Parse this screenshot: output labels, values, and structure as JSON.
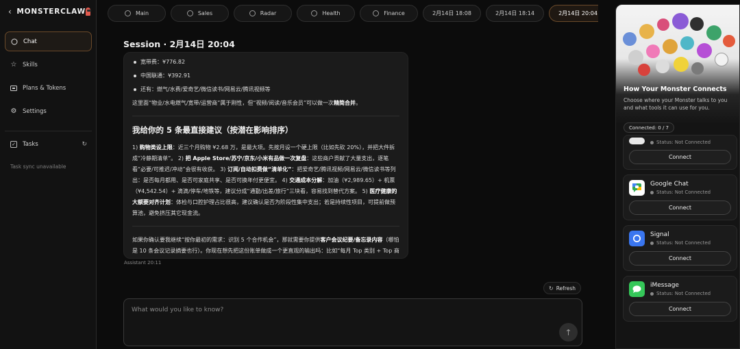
{
  "brand": {
    "name": "MONSTERCLAW",
    "back_icon": "chevron-left-icon",
    "logo_icon": "monster-icon"
  },
  "sidebar": {
    "items": [
      {
        "label": "Chat",
        "icon": "chat-bubble-icon",
        "active": true
      },
      {
        "label": "Skills",
        "icon": "sparkle-icon",
        "active": false
      },
      {
        "label": "Plans & Tokens",
        "icon": "card-icon",
        "active": false
      },
      {
        "label": "Settings",
        "icon": "gear-icon",
        "active": false
      }
    ],
    "tasks_label": "Tasks",
    "tasks_note": "Task sync unavailable"
  },
  "tabs": [
    {
      "label": "Main",
      "icon": "plus-circle-icon"
    },
    {
      "label": "Sales",
      "icon": "chart-icon"
    },
    {
      "label": "Radar",
      "icon": "radar-icon"
    },
    {
      "label": "Health",
      "icon": "heart-icon"
    },
    {
      "label": "Finance",
      "icon": "wallet-icon"
    },
    {
      "label": "2月14日 18:08"
    },
    {
      "label": "2月14日 18:14"
    },
    {
      "label": "2月14日 20:04",
      "active": true
    }
  ],
  "session": {
    "title": "Session · 2月14日 20:04",
    "bullets": [
      "宽带费：¥776.82",
      "中国联通：¥392.91",
      "还有：燃气/水费/爱奇艺/微信读书/网易云/腾讯视频等"
    ],
    "para_prefix": "这里面“物业/水电燃气/宽带/运营商”属于刚性，但“视频/阅读/音乐会员”可以做一次",
    "para_bold": "精简合并",
    "para_suffix": "。",
    "heading": "我给你的 5 条最直接建议（按潜在影响排序）",
    "rec_1": "1) ",
    "rec_1b": "购物类设上限",
    "rec_1t": "：近三个月购物 ¥2.68 万，是最大项。先按月设一个硬上限（比如先砍 20%），并把大件拆成“冷静期清单”。 2) ",
    "rec_2b": "把 Apple Store/苏宁/京东/小米有品做一次复盘",
    "rec_2t": "：这些商户贡献了大量支出，逐笔看“必要/可推迟/冲动”会很有收获。 3) ",
    "rec_3b": "订阅/自动扣费做“清单化”",
    "rec_3t": "：把爱奇艺/腾讯视频/网易云/微信读书等列出：是否每月都用、是否可家庭共享、是否可换年付更便宜。 4) ",
    "rec_4b": "交通成本分解",
    "rec_4t": "：加油（¥2,989.65）+ 机票（¥4,542.54）+ 滴滴/停车/地铁等，建议分成“通勤/出差/旅行”三块看，容易找到替代方案。 5) ",
    "rec_5b": "医疗健康的大额要对齐计划",
    "rec_5t": "：体检与口腔护理占比很高，建议确认是否为阶段性集中支出；若是持续性项目，可提前做预算池，避免挤压其它现金流。",
    "closing_a": "如果你确认要我继续“按你最初的需求：识别 5 个合作机会”，那就需要你提供",
    "closing_b": "客户会议纪要/备忘录内容",
    "closing_c": "（哪怕是 10 条会议记录摘要也行）。你现在想先把这份账单做成一个更直观的输出吗：比如“每月 Top 类别 + Top 商户 + 可削减清单”我可以按你的目标（省钱/控预算/做预算）生成一版。",
    "meta": "Assistant 20:11"
  },
  "refresh_label": "Refresh",
  "composer": {
    "placeholder": "What would you like to know?",
    "send_icon": "arrow-up-icon"
  },
  "panel": {
    "title": "How Your Monster Connects",
    "description": "Choose where your Monster talks to you and what tools it can use for you.",
    "badge": "Connected: 0 / 7",
    "cards": [
      {
        "name": "",
        "status": "Status: Not Connected",
        "button": "Connect",
        "icon": "app-icon",
        "color": "#e8e8e8"
      },
      {
        "name": "Google Chat",
        "status": "Status: Not Connected",
        "button": "Connect",
        "icon": "google-chat-icon",
        "color": "#ffffff"
      },
      {
        "name": "Signal",
        "status": "Status: Not Connected",
        "button": "Connect",
        "icon": "signal-icon",
        "color": "#3a76f0"
      },
      {
        "name": "iMessage",
        "status": "Status: Not Connected",
        "button": "Connect",
        "icon": "imessage-icon",
        "color": "#35c759"
      }
    ]
  }
}
